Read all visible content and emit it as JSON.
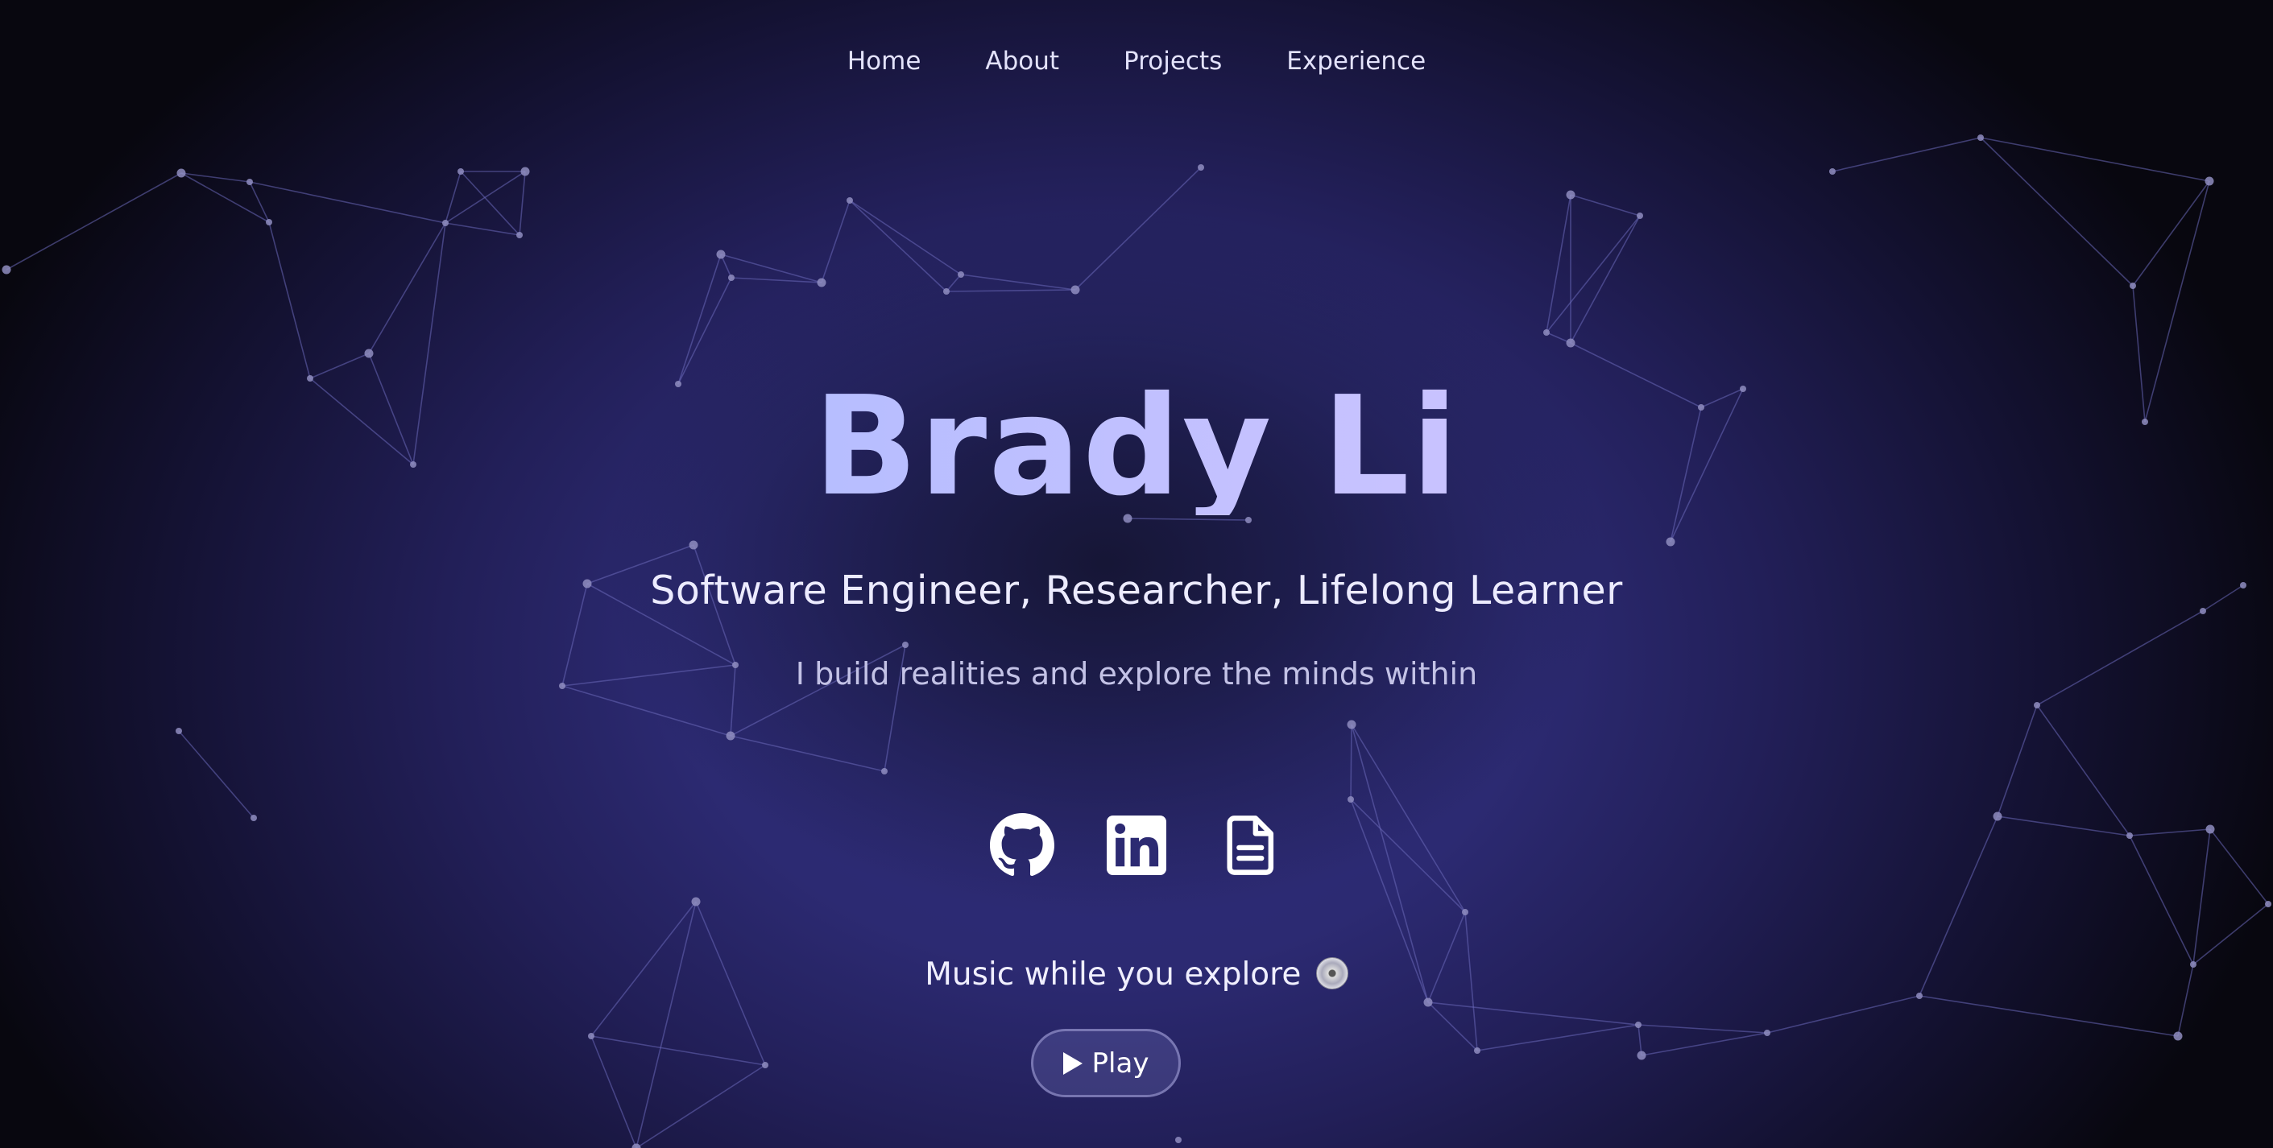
{
  "nav": {
    "items": [
      {
        "label": "Home"
      },
      {
        "label": "About"
      },
      {
        "label": "Projects"
      },
      {
        "label": "Experience"
      }
    ]
  },
  "hero": {
    "name": "Brady Li",
    "subtitle": "Software Engineer, Researcher, Lifelong Learner",
    "tagline": "I build realities and explore the minds within"
  },
  "socials": [
    {
      "icon": "github-icon"
    },
    {
      "icon": "linkedin-icon"
    },
    {
      "icon": "document-icon"
    }
  ],
  "music": {
    "label": "Music while you explore",
    "icon": "disc-icon",
    "play_label": "Play"
  },
  "colors": {
    "background_center": "#2f2c7a",
    "background_edge": "#08070f",
    "title_gradient_start": "#9db7ff",
    "title_gradient_end": "#d9c6ff",
    "node": "#8f8dc0",
    "line": "#6a68b8"
  }
}
